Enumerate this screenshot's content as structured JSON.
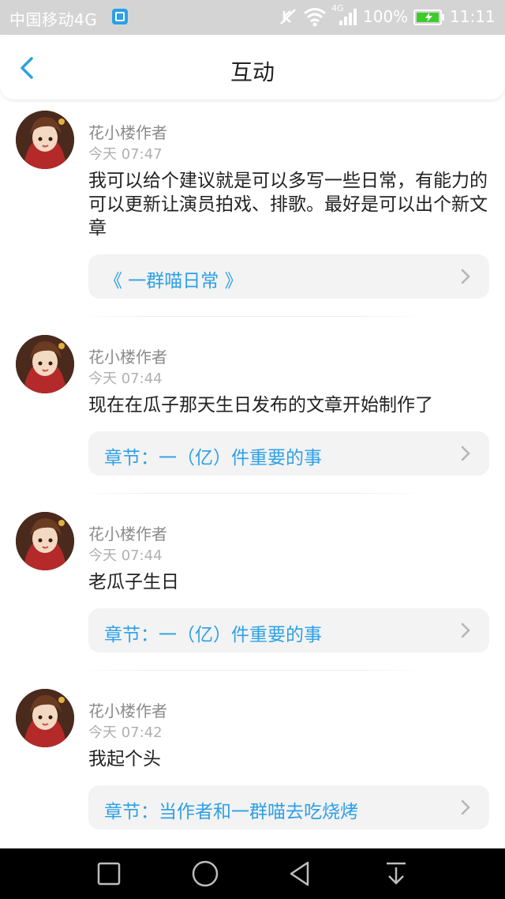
{
  "status_bar": {
    "carrier": "中国移动4G",
    "network": "4G",
    "battery": "100%",
    "time": "11:11",
    "icons": [
      "sim-card-icon",
      "mute-icon",
      "wifi-icon",
      "signal-icon",
      "battery-charging-icon"
    ]
  },
  "header": {
    "title": "互动",
    "back_icon": "chevron-left-icon"
  },
  "colors": {
    "accent": "#2ea0e6",
    "status_bar_bg": "#d4d4d4",
    "card_bg": "#f3f3f3",
    "nav_bar_bg": "#000000"
  },
  "items": [
    {
      "author": "花小楼作者",
      "time": "今天 07:47",
      "text": "我可以给个建议就是可以多写一些日常，有能力的可以更新让演员拍戏、排歌。最好是可以出个新文章",
      "link": "《 一群喵日常 》"
    },
    {
      "author": "花小楼作者",
      "time": "今天 07:44",
      "text": "现在在瓜子那天生日发布的文章开始制作了",
      "link": "章节：一（亿）件重要的事"
    },
    {
      "author": "花小楼作者",
      "time": "今天 07:44",
      "text": "老瓜子生日",
      "link": "章节：一（亿）件重要的事"
    },
    {
      "author": "花小楼作者",
      "time": "今天 07:42",
      "text": "我起个头",
      "link": "章节：当作者和一群喵去吃烧烤"
    }
  ],
  "nav_bar": {
    "icons": [
      "recent-apps-icon",
      "home-icon",
      "back-icon",
      "notification-pull-icon"
    ]
  }
}
